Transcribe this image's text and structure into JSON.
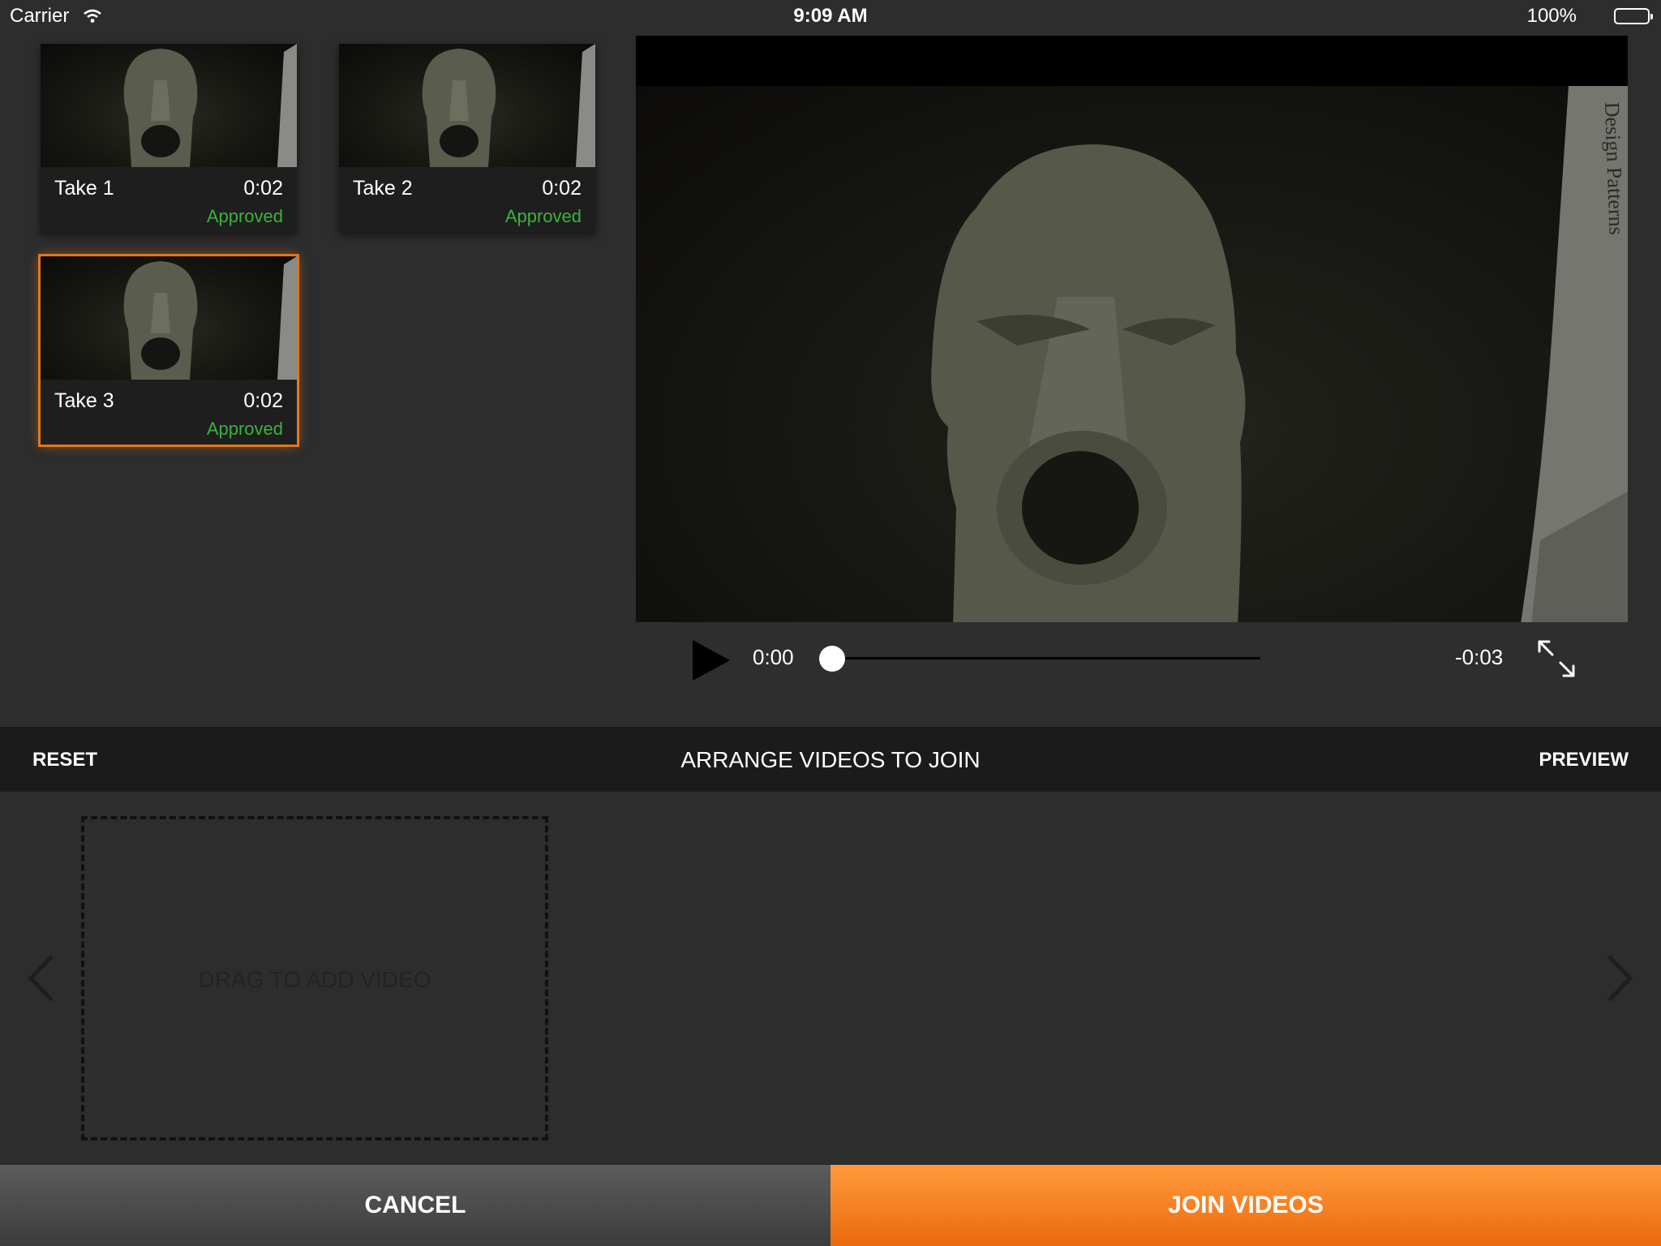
{
  "status_bar": {
    "carrier": "Carrier",
    "time": "9:09 AM",
    "battery": "100%"
  },
  "clips": [
    {
      "label": "Take 1",
      "duration": "0:02",
      "status": "Approved",
      "selected": false
    },
    {
      "label": "Take 2",
      "duration": "0:02",
      "status": "Approved",
      "selected": false
    },
    {
      "label": "Take 3",
      "duration": "0:02",
      "status": "Approved",
      "selected": true
    }
  ],
  "player": {
    "current_time": "0:00",
    "remaining_time": "-0:03",
    "progress": 0,
    "book_spine_text": "Design Patterns"
  },
  "arrange_bar": {
    "reset": "RESET",
    "title": "ARRANGE VIDEOS TO JOIN",
    "preview": "PREVIEW"
  },
  "dropzone": {
    "hint": "DRAG TO ADD VIDEO"
  },
  "buttons": {
    "cancel": "CANCEL",
    "join": "JOIN VIDEOS"
  },
  "colors": {
    "accent": "#f07d1e",
    "approved": "#3bb33b",
    "background": "#2d2d2d"
  }
}
